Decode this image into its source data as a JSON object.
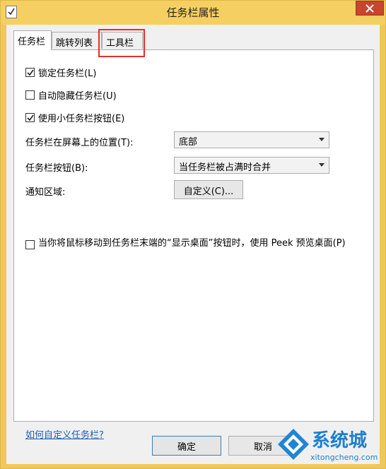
{
  "window": {
    "title": "任务栏属性"
  },
  "tabs": [
    {
      "label": "任务栏",
      "active": true
    },
    {
      "label": "跳转列表",
      "active": false
    },
    {
      "label": "工具栏",
      "active": false
    }
  ],
  "options": {
    "lock_taskbar": {
      "label": "锁定任务栏(L)",
      "checked": true
    },
    "auto_hide": {
      "label": "自动隐藏任务栏(U)",
      "checked": false
    },
    "small_buttons": {
      "label": "使用小任务栏按钮(E)",
      "checked": true
    }
  },
  "location": {
    "label": "任务栏在屏幕上的位置(T):",
    "value": "底部"
  },
  "buttons_combine": {
    "label": "任务栏按钮(B):",
    "value": "当任务栏被占满时合并"
  },
  "notification": {
    "label": "通知区域:",
    "button": "自定义(C)..."
  },
  "peek": {
    "label": "当你将鼠标移动到任务栏末端的“显示桌面”按钮时，使用 Peek 预览桌面(P)",
    "checked": false
  },
  "help_link": "如何自定义任务栏?",
  "footer": {
    "ok": "确定",
    "cancel": "取消"
  },
  "watermark": {
    "brand": "系统城",
    "url": "xitongcheng.com"
  },
  "colors": {
    "title_bar": "#f6cf62",
    "close": "#c8452f",
    "highlight": "#e0302a",
    "link": "#1a5fb4"
  }
}
